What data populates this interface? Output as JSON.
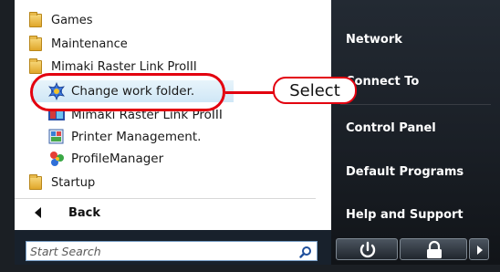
{
  "programs": {
    "items": [
      {
        "label": "Games",
        "icon": "folder-icon"
      },
      {
        "label": "Maintenance",
        "icon": "folder-icon"
      },
      {
        "label": "Mimaki Raster Link ProIII",
        "icon": "folder-icon"
      },
      {
        "label": "Change work folder.",
        "icon": "change-folder-icon",
        "highlighted": true
      },
      {
        "label": "Mimaki Raster Link ProIII",
        "icon": "rasterlink-icon"
      },
      {
        "label": "Printer Management.",
        "icon": "printer-management-icon"
      },
      {
        "label": "ProfileManager",
        "icon": "profile-manager-icon"
      },
      {
        "label": "Startup",
        "icon": "folder-icon"
      }
    ]
  },
  "back_label": "Back",
  "search": {
    "placeholder": "Start Search"
  },
  "right_pane": {
    "items": [
      "Network",
      "Connect To",
      "Control Panel",
      "Default Programs",
      "Help and Support"
    ]
  },
  "buttons": {
    "power": "power-icon",
    "lock": "lock-icon",
    "more": "triangle-right-icon"
  },
  "callout": {
    "label": "Select"
  },
  "colors": {
    "accent": "#e3000f",
    "highlight": "#cfe7f6",
    "dark_pane": "#1a1f26"
  }
}
